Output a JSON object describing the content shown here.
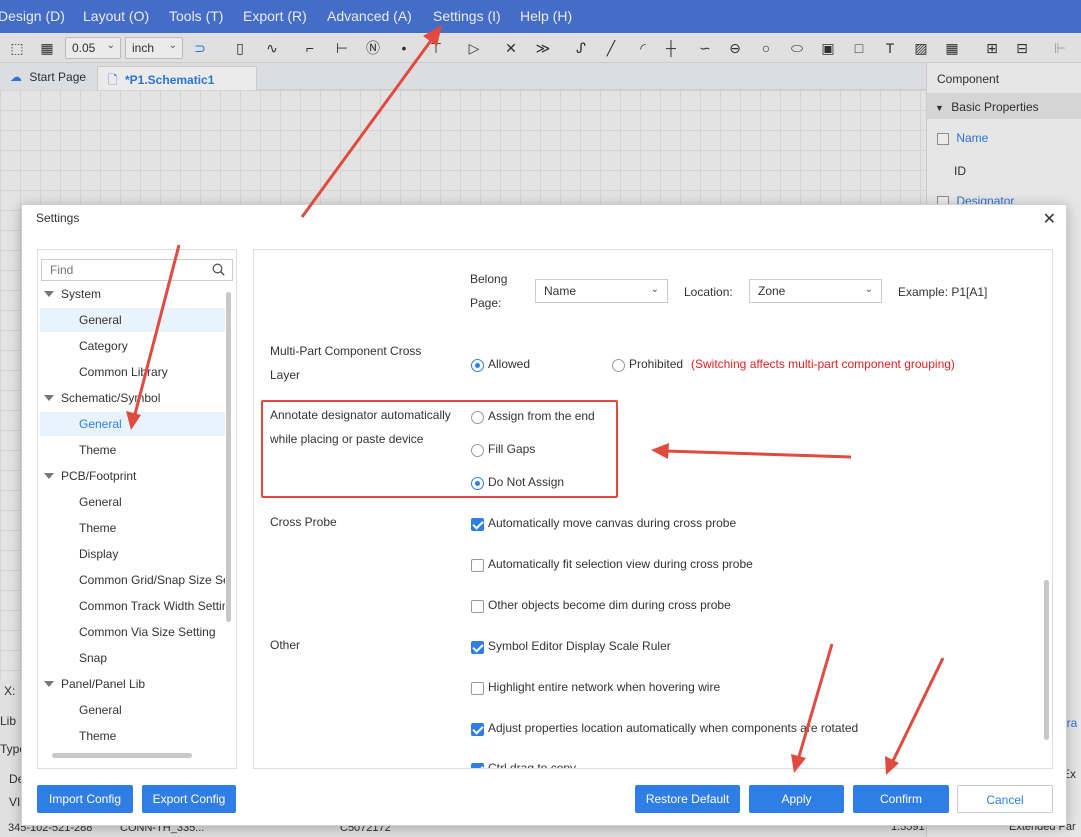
{
  "menubar": {
    "items": [
      "Design (D)",
      "Layout (O)",
      "Tools (T)",
      "Export (R)",
      "Advanced (A)",
      "Settings (I)",
      "Help (H)"
    ]
  },
  "toolbar": {
    "grid_value": "0.05",
    "unit": "inch"
  },
  "tabs": [
    {
      "label": "Start Page",
      "icon": "cloud-icon"
    },
    {
      "label": "*P1.Schematic1",
      "icon": "document-icon",
      "active": true
    }
  ],
  "right_panel": {
    "title": "Component",
    "section": "Basic Properties",
    "fields": [
      "Name",
      "ID",
      "Designator"
    ]
  },
  "bottom_bar": {
    "left_labels": [
      "X:",
      "Lib",
      "Type",
      "De",
      "VI"
    ],
    "row_fragments": [
      "345-102-521-288",
      "CONN-TH_335...",
      "C5072172",
      "1.5591",
      "Extended Par"
    ],
    "right_labels": [
      "era",
      "Extended Par",
      "Ex"
    ]
  },
  "dialog": {
    "title": "Settings",
    "close_label": "✕",
    "find_placeholder": "Find",
    "nav": [
      {
        "type": "group",
        "label": "System"
      },
      {
        "type": "child",
        "label": "General",
        "selected": true
      },
      {
        "type": "child",
        "label": "Category"
      },
      {
        "type": "child",
        "label": "Common Library"
      },
      {
        "type": "group",
        "label": "Schematic/Symbol"
      },
      {
        "type": "child",
        "label": "General",
        "selected": true
      },
      {
        "type": "child",
        "label": "Theme"
      },
      {
        "type": "group",
        "label": "PCB/Footprint"
      },
      {
        "type": "child",
        "label": "General"
      },
      {
        "type": "child",
        "label": "Theme"
      },
      {
        "type": "child",
        "label": "Display"
      },
      {
        "type": "child",
        "label": "Common Grid/Snap Size Setting"
      },
      {
        "type": "child",
        "label": "Common Track Width Setting"
      },
      {
        "type": "child",
        "label": "Common Via Size Setting"
      },
      {
        "type": "child",
        "label": "Snap"
      },
      {
        "type": "group",
        "label": "Panel/Panel Lib"
      },
      {
        "type": "child",
        "label": "General"
      },
      {
        "type": "child",
        "label": "Theme"
      }
    ],
    "content": {
      "belong_page_label_1": "Belong",
      "belong_page_label_2": "Page:",
      "belong_page_value": "Name",
      "location_label": "Location:",
      "location_value": "Zone",
      "example_text": "Example: P1[A1]",
      "multipart_label_1": "Multi-Part Component Cross",
      "multipart_label_2": "Layer",
      "allowed_label": "Allowed",
      "prohibited_label": "Prohibited",
      "multipart_note": "(Switching affects multi-part component grouping)",
      "multipart_note_color": "#e02020",
      "annotate_label_1": "Annotate designator automatically",
      "annotate_label_2": "while placing or paste device",
      "annotate_options": [
        "Assign from the end",
        "Fill Gaps",
        "Do Not Assign"
      ],
      "annotate_selected": "Do Not Assign",
      "cross_probe_label": "Cross Probe",
      "cross_probe_options": [
        {
          "label": "Automatically move canvas during cross probe",
          "checked": true
        },
        {
          "label": "Automatically fit selection view during cross probe",
          "checked": false
        },
        {
          "label": "Other objects become dim during cross probe",
          "checked": false
        }
      ],
      "other_label": "Other",
      "other_options": [
        {
          "label": "Symbol Editor Display Scale Ruler",
          "checked": true
        },
        {
          "label": "Highlight entire network when hovering wire",
          "checked": false
        },
        {
          "label": "Adjust properties location automatically when components are rotated",
          "checked": true
        },
        {
          "label": "Ctrl drag to copy",
          "checked": true
        }
      ]
    },
    "buttons": {
      "import": "Import Config",
      "export": "Export Config",
      "restore": "Restore Default",
      "apply": "Apply",
      "confirm": "Confirm",
      "cancel": "Cancel"
    }
  },
  "colors": {
    "menubar": "#4a77d8",
    "accent": "#2f7ee5",
    "annotation_arrow": "#e04a3f"
  }
}
